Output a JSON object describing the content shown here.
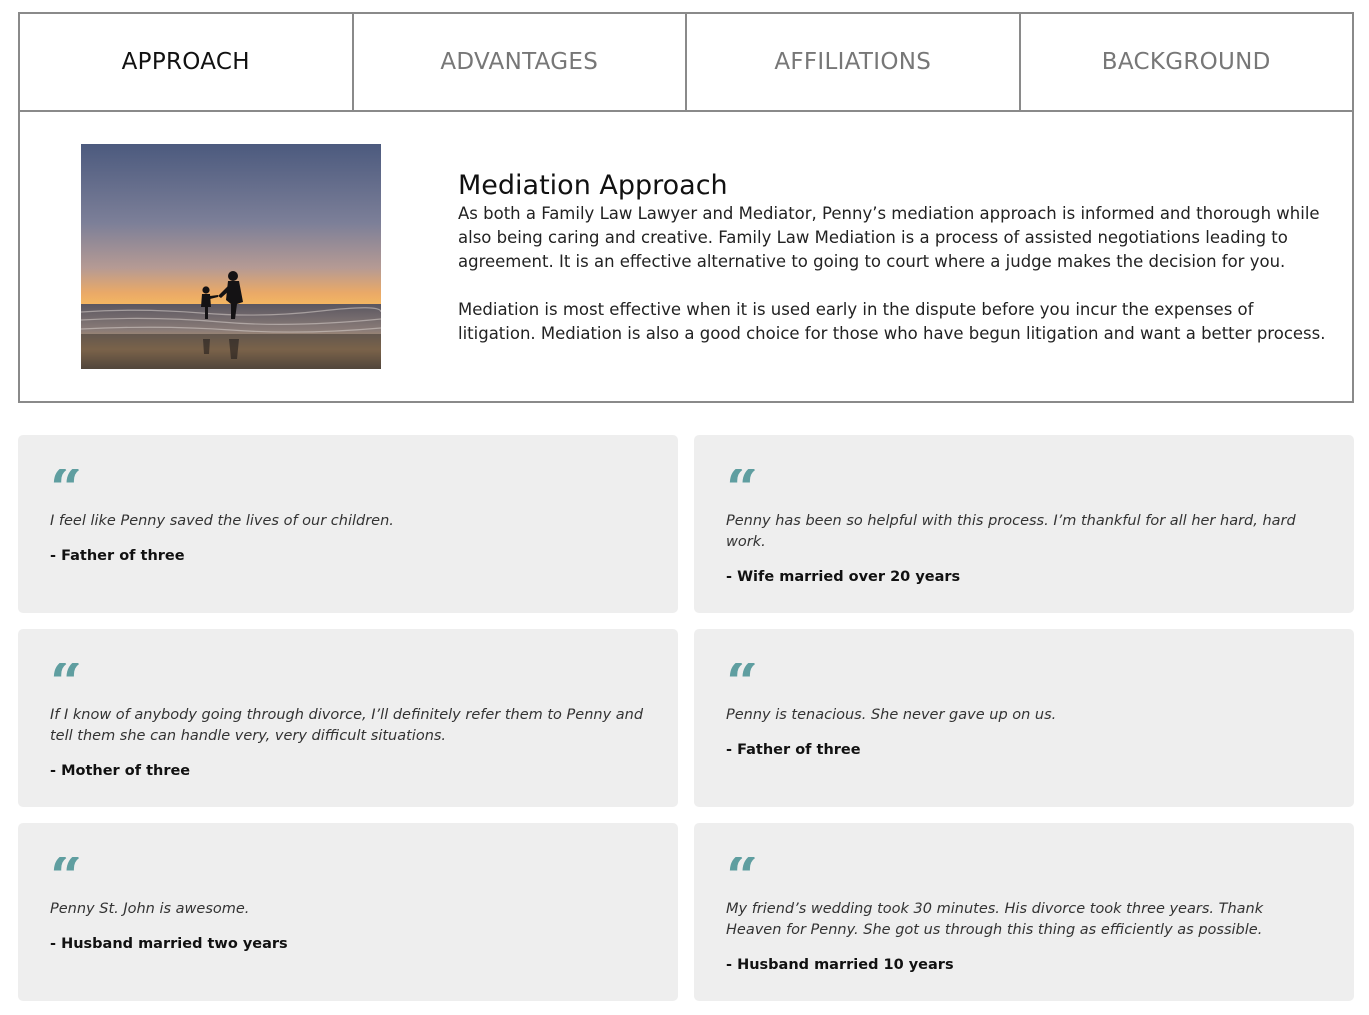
{
  "tabs": [
    {
      "label": "APPROACH",
      "active": true
    },
    {
      "label": "ADVANTAGES",
      "active": false
    },
    {
      "label": "AFFILIATIONS",
      "active": false
    },
    {
      "label": "BACKGROUND",
      "active": false
    }
  ],
  "approach": {
    "title": "Mediation Approach",
    "paragraphs": [
      "As both a Family Law Lawyer and Mediator, Penny’s mediation approach is informed and thorough while also being caring and creative. Family Law Mediation is a process of assisted negotiations leading to agreement. It is an effective alternative to going to court where a judge makes the decision for you.",
      "Mediation is most effective when it is used early in the dispute before you incur the expenses of litigation. Mediation is also a good choice for those who have begun litigation and want a better process."
    ]
  },
  "testimonials": [
    {
      "quote_icon": "“",
      "text": "I feel like Penny saved the lives of our children.",
      "author": "- Father of three"
    },
    {
      "quote_icon": "“",
      "text": "Penny has been so helpful with this process. I’m thankful for all her hard, hard work.",
      "author": "- Wife married over 20 years"
    },
    {
      "quote_icon": "“",
      "text": "If I know of anybody going through divorce, I’ll definitely refer them to Penny and tell them she can handle very, very difficult situations.",
      "author": "- Mother of three"
    },
    {
      "quote_icon": "“",
      "text": "Penny is tenacious. She never gave up on us.",
      "author": "- Father of three"
    },
    {
      "quote_icon": "“",
      "text": "Penny St. John is awesome.",
      "author": "- Husband married two years"
    },
    {
      "quote_icon": "“",
      "text": "My friend’s wedding took 30 minutes. His divorce took three years. Thank Heaven for Penny. She got us through this thing as efficiently as possible.",
      "author": "- Husband married 10 years"
    }
  ],
  "colors": {
    "quote_accent": "#5f9ea0",
    "card_background": "#eeeeee",
    "panel_border": "#8a8a8a"
  }
}
